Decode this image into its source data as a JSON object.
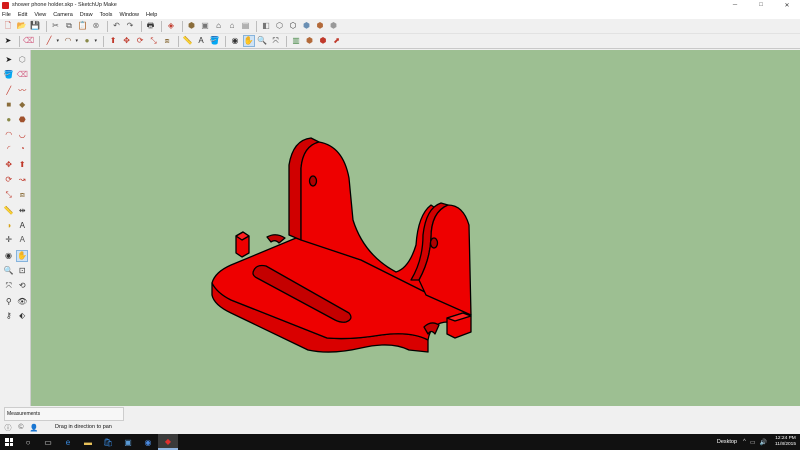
{
  "window": {
    "title": "shower phone holder.skp - SketchUp Make",
    "controls": {
      "minimize": "─",
      "maximize": "□",
      "close": "✕"
    }
  },
  "menu": [
    "File",
    "Edit",
    "View",
    "Camera",
    "Draw",
    "Tools",
    "Window",
    "Help"
  ],
  "toolbar_row1": [
    {
      "name": "new-icon",
      "glyph": "🗋",
      "color": "#c0392b"
    },
    {
      "name": "open-icon",
      "glyph": "📂",
      "color": "#d4a017"
    },
    {
      "name": "save-icon",
      "glyph": "💾",
      "color": "#2f5fa7"
    },
    {
      "sep": true
    },
    {
      "name": "cut-icon",
      "glyph": "✂",
      "color": "#555"
    },
    {
      "name": "copy-icon",
      "glyph": "⧉",
      "color": "#555"
    },
    {
      "name": "paste-icon",
      "glyph": "📋",
      "color": "#8a6d3b"
    },
    {
      "name": "erase-icon",
      "glyph": "⊗",
      "color": "#777"
    },
    {
      "sep": true
    },
    {
      "name": "undo-icon",
      "glyph": "↶",
      "color": "#555"
    },
    {
      "name": "redo-icon",
      "glyph": "↷",
      "color": "#555"
    },
    {
      "sep": true
    },
    {
      "name": "print-icon",
      "glyph": "🖶",
      "color": "#333"
    },
    {
      "sep": true
    },
    {
      "name": "model-info-icon",
      "glyph": "◈",
      "color": "#c0392b"
    },
    {
      "sep": true
    },
    {
      "name": "iso-view-icon",
      "glyph": "⬢",
      "color": "#8a6d3b"
    },
    {
      "name": "top-view-icon",
      "glyph": "▣",
      "color": "#777"
    },
    {
      "name": "front-view-icon",
      "glyph": "⌂",
      "color": "#333"
    },
    {
      "name": "right-view-icon",
      "glyph": "⌂",
      "color": "#555"
    },
    {
      "name": "back-view-icon",
      "glyph": "▤",
      "color": "#777"
    },
    {
      "sep": true
    },
    {
      "name": "xray-icon",
      "glyph": "◧",
      "color": "#777"
    },
    {
      "name": "wireframe-icon",
      "glyph": "⬡",
      "color": "#555"
    },
    {
      "name": "hidden-line-icon",
      "glyph": "⬡",
      "color": "#333"
    },
    {
      "name": "shaded-icon",
      "glyph": "⬢",
      "color": "#6a8fb3"
    },
    {
      "name": "shaded-textures-icon",
      "glyph": "⬢",
      "color": "#b36a3a"
    },
    {
      "name": "monochrome-icon",
      "glyph": "⬢",
      "color": "#999"
    }
  ],
  "toolbar_row2": [
    {
      "name": "select-icon",
      "glyph": "➤",
      "color": "#222"
    },
    {
      "sep": true
    },
    {
      "name": "eraser-icon",
      "glyph": "⌫",
      "color": "#d46a8a"
    },
    {
      "sep": true
    },
    {
      "name": "line-icon",
      "glyph": "╱",
      "color": "#c0392b",
      "dd": true
    },
    {
      "name": "arc-icon",
      "glyph": "◠",
      "color": "#8a5a3b",
      "dd": true
    },
    {
      "name": "shape-icon",
      "glyph": "●",
      "color": "#8a8a4a",
      "dd": true
    },
    {
      "sep": true
    },
    {
      "name": "push-pull-icon",
      "glyph": "⬆",
      "color": "#c0392b"
    },
    {
      "name": "move-icon",
      "glyph": "✥",
      "color": "#c0392b"
    },
    {
      "name": "rotate-icon",
      "glyph": "⟳",
      "color": "#c0392b"
    },
    {
      "name": "scale-icon",
      "glyph": "⤡",
      "color": "#c0392b"
    },
    {
      "name": "offset-icon",
      "glyph": "⧈",
      "color": "#8a6d3b"
    },
    {
      "sep": true
    },
    {
      "name": "tape-measure-icon",
      "glyph": "📏",
      "color": "#d4a017"
    },
    {
      "name": "text-icon",
      "glyph": "A",
      "color": "#333"
    },
    {
      "name": "paint-bucket-icon",
      "glyph": "🪣",
      "color": "#2f5fa7"
    },
    {
      "sep": true
    },
    {
      "name": "orbit-icon",
      "glyph": "◉",
      "color": "#333"
    },
    {
      "name": "pan-icon",
      "glyph": "✋",
      "color": "#555",
      "active": true
    },
    {
      "name": "zoom-icon",
      "glyph": "🔍",
      "color": "#333"
    },
    {
      "name": "zoom-extents-icon",
      "glyph": "⤧",
      "color": "#333"
    },
    {
      "sep": true
    },
    {
      "name": "warehouse-icon",
      "glyph": "▥",
      "color": "#4a8a4a"
    },
    {
      "name": "components-icon",
      "glyph": "⬢",
      "color": "#b36a3a"
    },
    {
      "name": "extension-warehouse-icon",
      "glyph": "⬢",
      "color": "#c0392b"
    },
    {
      "name": "share-model-icon",
      "glyph": "⬈",
      "color": "#c0392b"
    }
  ],
  "left_tools": [
    [
      {
        "name": "select-tool-icon",
        "glyph": "➤",
        "color": "#222"
      },
      {
        "name": "make-component-icon",
        "glyph": "⬡",
        "color": "#777"
      }
    ],
    [
      {
        "name": "paint-tool-icon",
        "glyph": "🪣",
        "color": "#d4a017"
      },
      {
        "name": "eraser-tool-icon",
        "glyph": "⌫",
        "color": "#d46a8a"
      }
    ],
    [
      {
        "name": "line-tool-icon",
        "glyph": "╱",
        "color": "#c0392b",
        "gap": true
      },
      {
        "name": "freehand-tool-icon",
        "glyph": "〰",
        "color": "#c0392b"
      }
    ],
    [
      {
        "name": "rectangle-tool-icon",
        "glyph": "■",
        "color": "#8a6d3b"
      },
      {
        "name": "rotated-rectangle-icon",
        "glyph": "◆",
        "color": "#8a6d3b"
      }
    ],
    [
      {
        "name": "circle-tool-icon",
        "glyph": "●",
        "color": "#8a8a4a"
      },
      {
        "name": "polygon-tool-icon",
        "glyph": "⬣",
        "color": "#a0522d"
      }
    ],
    [
      {
        "name": "arc-tool-icon",
        "glyph": "◠",
        "color": "#c0392b"
      },
      {
        "name": "two-point-arc-icon",
        "glyph": "◡",
        "color": "#c0392b"
      }
    ],
    [
      {
        "name": "three-point-arc-icon",
        "glyph": "◜",
        "color": "#c0392b"
      },
      {
        "name": "pie-tool-icon",
        "glyph": "◔",
        "color": "#c0392b"
      }
    ],
    [
      {
        "name": "move-tool-icon",
        "glyph": "✥",
        "color": "#c0392b",
        "gap": true
      },
      {
        "name": "push-pull-tool-icon",
        "glyph": "⬆",
        "color": "#c0392b"
      }
    ],
    [
      {
        "name": "rotate-tool-icon",
        "glyph": "⟳",
        "color": "#c0392b"
      },
      {
        "name": "follow-me-icon",
        "glyph": "↝",
        "color": "#c0392b"
      }
    ],
    [
      {
        "name": "scale-tool-icon",
        "glyph": "⤡",
        "color": "#c0392b"
      },
      {
        "name": "offset-tool-icon",
        "glyph": "⧈",
        "color": "#8a6d3b"
      }
    ],
    [
      {
        "name": "tape-measure-tool-icon",
        "glyph": "📏",
        "color": "#d4a017",
        "gap": true
      },
      {
        "name": "dimension-tool-icon",
        "glyph": "⇹",
        "color": "#333"
      }
    ],
    [
      {
        "name": "protractor-tool-icon",
        "glyph": "◑",
        "color": "#d4a017"
      },
      {
        "name": "text-tool-icon",
        "glyph": "A",
        "color": "#333"
      }
    ],
    [
      {
        "name": "axes-tool-icon",
        "glyph": "✛",
        "color": "#333"
      },
      {
        "name": "3d-text-tool-icon",
        "glyph": "A",
        "color": "#555"
      }
    ],
    [
      {
        "name": "orbit-tool-icon",
        "glyph": "◉",
        "color": "#333",
        "gap": true
      },
      {
        "name": "pan-tool-icon",
        "glyph": "✋",
        "color": "#555",
        "active": true
      }
    ],
    [
      {
        "name": "zoom-tool-icon",
        "glyph": "🔍",
        "color": "#333"
      },
      {
        "name": "zoom-window-icon",
        "glyph": "⊡",
        "color": "#333"
      }
    ],
    [
      {
        "name": "zoom-extents-tool-icon",
        "glyph": "⤧",
        "color": "#333"
      },
      {
        "name": "previous-view-icon",
        "glyph": "⟲",
        "color": "#333"
      }
    ],
    [
      {
        "name": "position-camera-icon",
        "glyph": "⚲",
        "color": "#333",
        "gap": true
      },
      {
        "name": "look-around-icon",
        "glyph": "👁",
        "color": "#333"
      }
    ],
    [
      {
        "name": "walk-tool-icon",
        "glyph": "⚷",
        "color": "#333"
      },
      {
        "name": "section-plane-icon",
        "glyph": "⬖",
        "color": "#333"
      }
    ]
  ],
  "viewport": {
    "background": "#9dbf92",
    "model_color": "#ee0000"
  },
  "measurements": {
    "label": "Measurements",
    "value": ""
  },
  "status": {
    "text": "Drag in direction to pan",
    "icons": [
      {
        "name": "geo-location-icon",
        "glyph": "ⓘ",
        "color": "#555"
      },
      {
        "name": "credits-icon",
        "glyph": "©",
        "color": "#555"
      },
      {
        "name": "user-icon",
        "glyph": "👤",
        "color": "#555"
      }
    ]
  },
  "taskbar": {
    "apps": [
      {
        "name": "search-icon",
        "glyph": "○"
      },
      {
        "name": "task-view-icon",
        "glyph": "▭"
      },
      {
        "name": "edge-icon",
        "glyph": "e",
        "color": "#3a8ee6"
      },
      {
        "name": "file-explorer-icon",
        "glyph": "▬",
        "color": "#e8c15a"
      },
      {
        "name": "store-icon",
        "glyph": "🛍",
        "color": "#3a8ee6"
      },
      {
        "name": "photos-icon",
        "glyph": "▣",
        "color": "#5a9ad6"
      },
      {
        "name": "chrome-icon",
        "glyph": "◉",
        "color": "#4a8ae0"
      },
      {
        "name": "sketchup-taskbar-icon",
        "glyph": "◆",
        "color": "#e03030",
        "active": true
      }
    ],
    "tray_label": "Desktop",
    "tray_icons": [
      "^",
      "▭",
      "🔊"
    ],
    "time": "12:24 PM",
    "date": "11/8/2015"
  }
}
